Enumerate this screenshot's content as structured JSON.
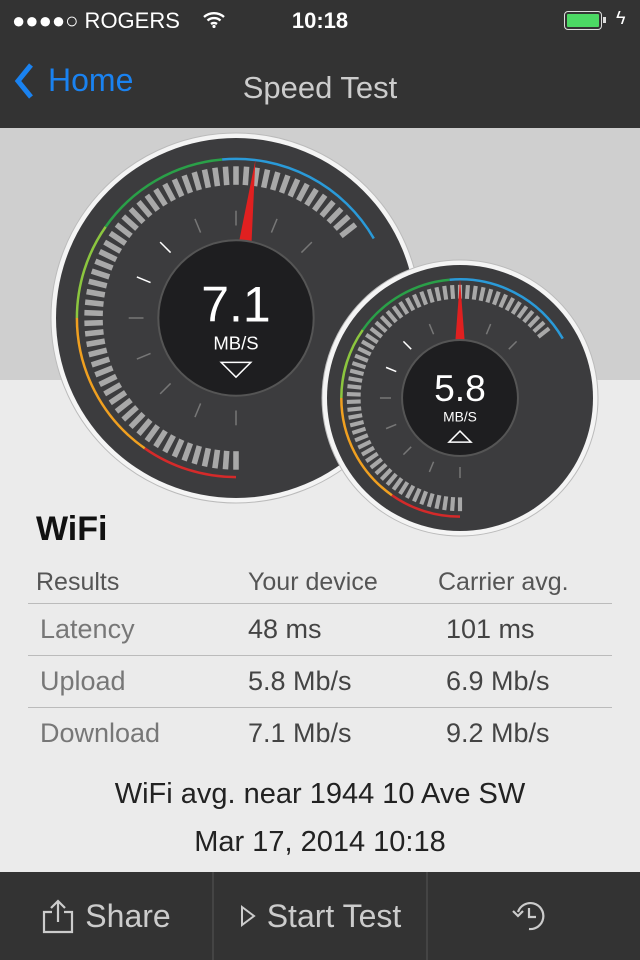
{
  "status": {
    "carrier": "●●●●○ ROGERS",
    "time": "10:18",
    "battery_level": 1.0
  },
  "nav": {
    "back_label": "Home",
    "title": "Speed Test"
  },
  "gauges": {
    "download": {
      "value": "7.1",
      "unit": "MB/S",
      "direction": "down"
    },
    "upload": {
      "value": "5.8",
      "unit": "MB/S",
      "direction": "up"
    }
  },
  "results": {
    "network": "WiFi",
    "headers": [
      "Results",
      "Your device",
      "Carrier avg."
    ],
    "rows": [
      [
        "Latency",
        "48 ms",
        "101 ms"
      ],
      [
        "Upload",
        "5.8 Mb/s",
        "6.9 Mb/s"
      ],
      [
        "Download",
        "7.1 Mb/s",
        "9.2 Mb/s"
      ]
    ]
  },
  "footer": {
    "location": "WiFi avg. near 1944 10 Ave SW",
    "datetime": "Mar 17, 2014 10:18"
  },
  "toolbar": {
    "share": "Share",
    "start": "Start Test"
  },
  "colors": {
    "accent": "#1a82f0",
    "needle": "#e02020"
  }
}
